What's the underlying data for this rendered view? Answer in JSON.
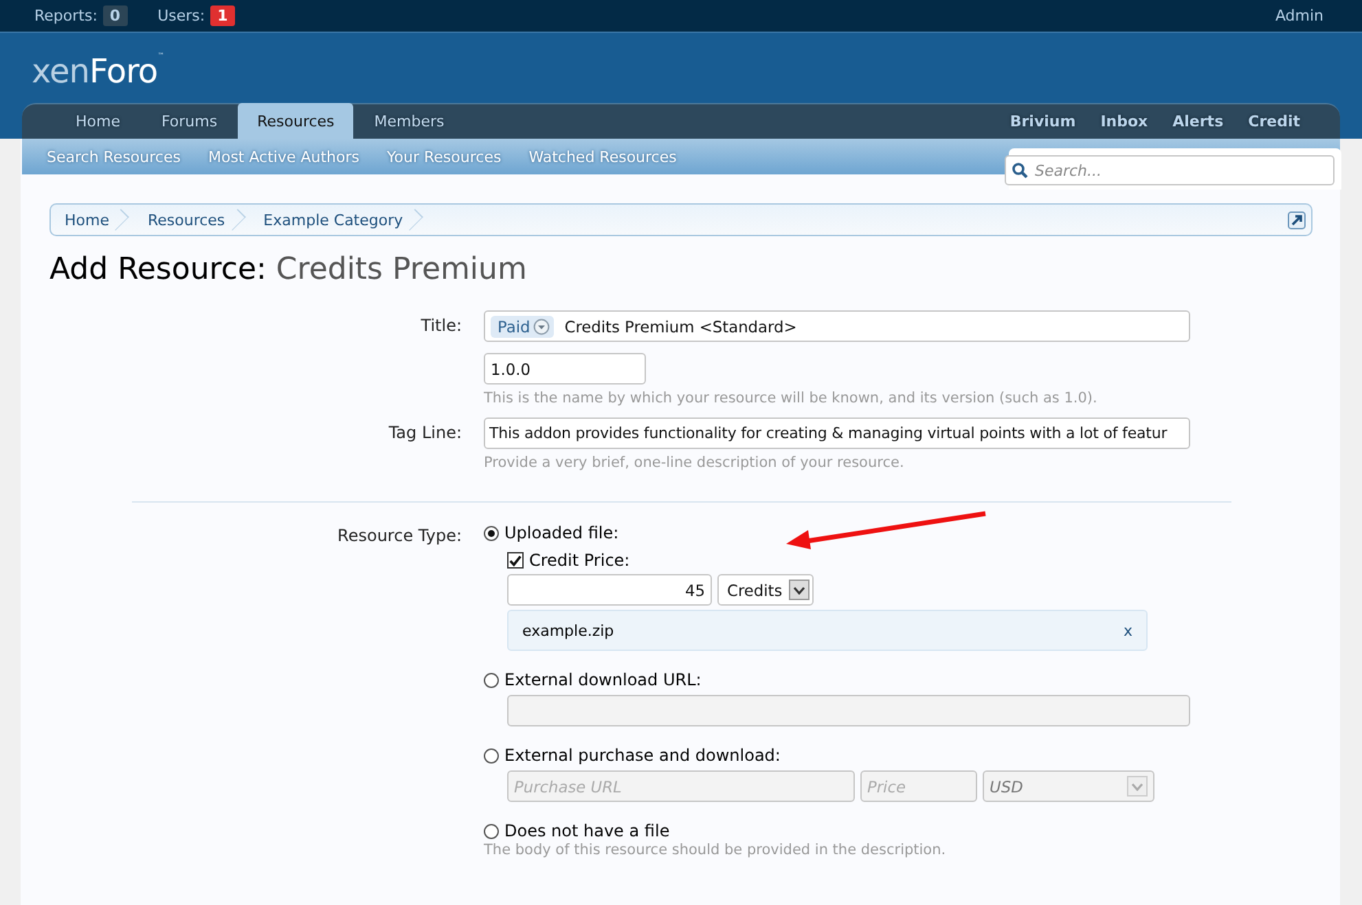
{
  "top_bar": {
    "counters": [
      {
        "label": "Reports:",
        "count": "0",
        "alert": false
      },
      {
        "label": "Users:",
        "count": "1",
        "alert": true
      }
    ],
    "account": "Admin"
  },
  "logo": {
    "light": "xen",
    "bold": "Foro",
    "mark": "™"
  },
  "nav": {
    "tabs": [
      {
        "label": "Home",
        "selected": false
      },
      {
        "label": "Forums",
        "selected": false
      },
      {
        "label": "Resources",
        "selected": true
      },
      {
        "label": "Members",
        "selected": false
      }
    ],
    "links": [
      "Brivium",
      "Inbox",
      "Alerts",
      "Credit"
    ]
  },
  "subnav": [
    "Search Resources",
    "Most Active Authors",
    "Your Resources",
    "Watched Resources"
  ],
  "search": {
    "placeholder": "Search..."
  },
  "breadcrumb": [
    "Home",
    "Resources",
    "Example Category"
  ],
  "heading": {
    "prefix": "Add Resource:",
    "title": "Credits Premium"
  },
  "form": {
    "title": {
      "label": "Title:",
      "prefix": "Paid",
      "value": "Credits Premium <Standard>",
      "version": "1.0.0",
      "hint": "This is the name by which your resource will be known, and its version (such as 1.0)."
    },
    "tag_line": {
      "label": "Tag Line:",
      "value": "This addon provides functionality for creating & managing virtual points with a lot of featur",
      "hint": "Provide a very brief, one-line description of your resource."
    },
    "resource_type": {
      "label": "Resource Type:",
      "options": [
        {
          "kind": "upload",
          "label": "Uploaded file:",
          "selected": true,
          "credit_price": {
            "label": "Credit Price:",
            "checked": true,
            "amount": "45",
            "currency": "Credits"
          },
          "file": "example.zip",
          "remove": "x"
        },
        {
          "kind": "url",
          "label": "External download URL:",
          "selected": false,
          "disabled": true
        },
        {
          "kind": "purchase",
          "label": "External purchase and download:",
          "selected": false,
          "disabled": true,
          "url_placeholder": "Purchase URL",
          "price_placeholder": "Price",
          "currency": "USD"
        },
        {
          "kind": "none",
          "label": "Does not have a file",
          "selected": false,
          "hint": "The body of this resource should be provided in the description."
        }
      ]
    }
  }
}
